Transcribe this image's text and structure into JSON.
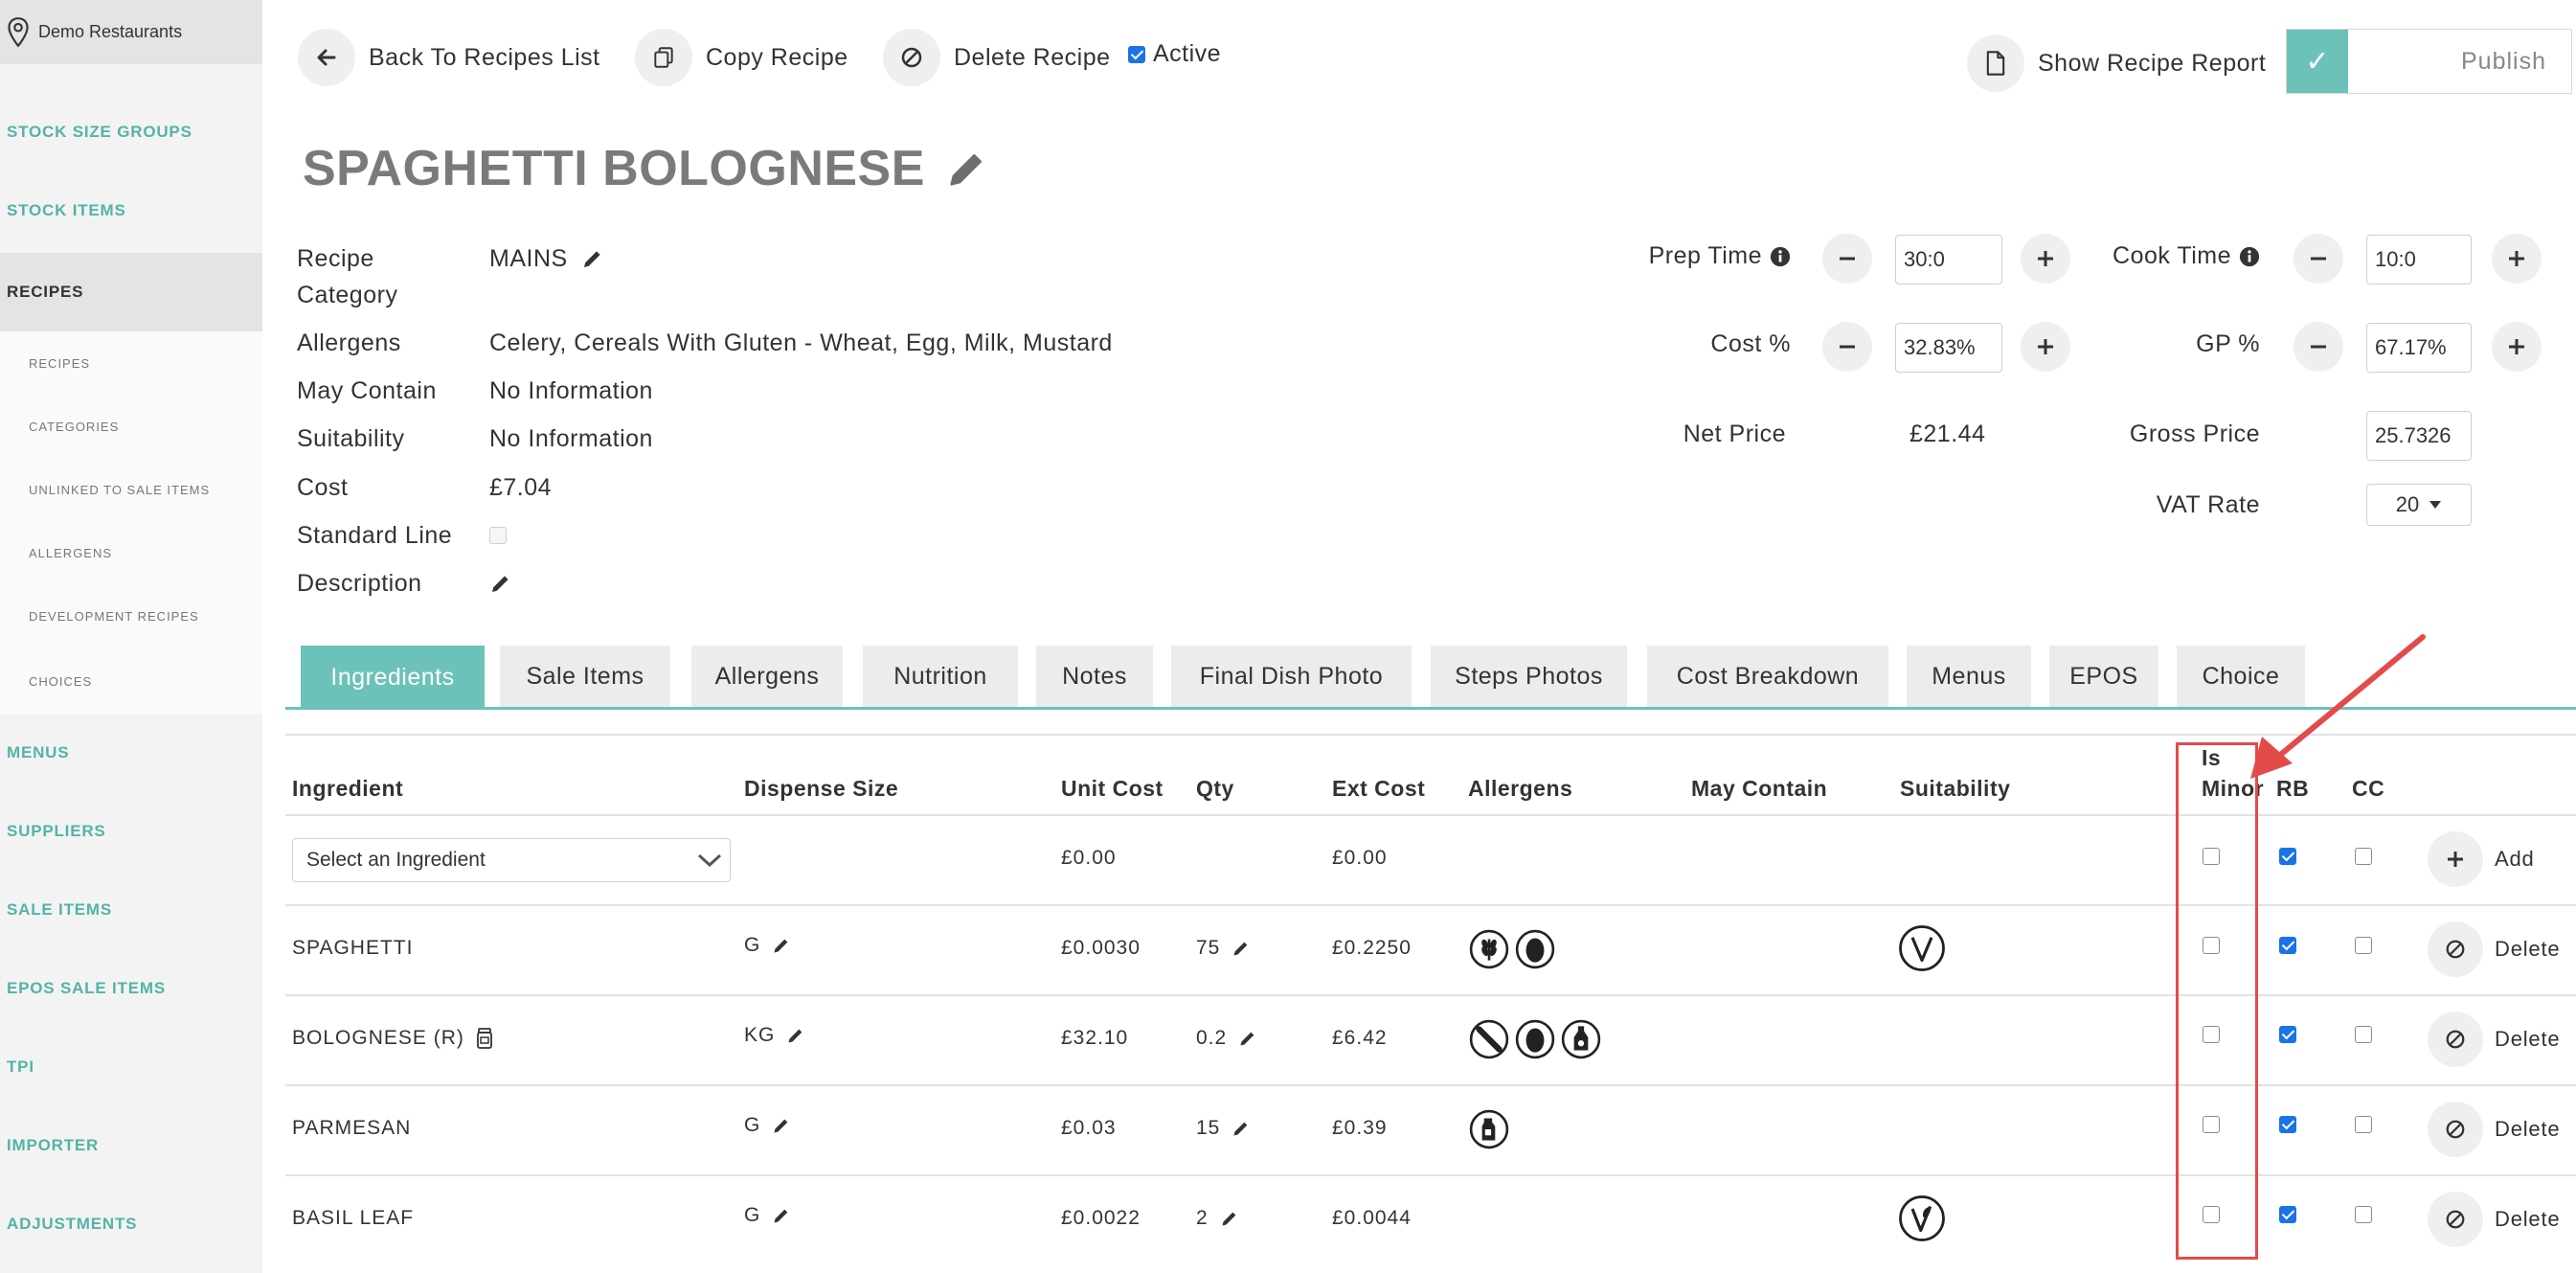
{
  "sidebar": {
    "location": "Demo Restaurants",
    "items": [
      {
        "label": "STOCK SIZE GROUPS"
      },
      {
        "label": "STOCK ITEMS"
      },
      {
        "label": "RECIPES"
      },
      {
        "label": "MENUS"
      },
      {
        "label": "SUPPLIERS"
      },
      {
        "label": "SALE ITEMS"
      },
      {
        "label": "EPOS SALE ITEMS"
      },
      {
        "label": "TPI"
      },
      {
        "label": "IMPORTER"
      },
      {
        "label": "ADJUSTMENTS"
      }
    ],
    "sub_items": [
      {
        "label": "RECIPES"
      },
      {
        "label": "CATEGORIES"
      },
      {
        "label": "UNLINKED TO SALE ITEMS"
      },
      {
        "label": "ALLERGENS"
      },
      {
        "label": "DEVELOPMENT RECIPES"
      },
      {
        "label": "CHOICES"
      }
    ]
  },
  "toolbar": {
    "back_label": "Back To Recipes List",
    "copy_label": "Copy Recipe",
    "delete_label": "Delete Recipe",
    "active_label": "Active",
    "active_checked": true,
    "report_label": "Show Recipe Report",
    "publish_label": "Publish"
  },
  "recipe": {
    "title": "SPAGHETTI BOLOGNESE",
    "info": {
      "category_label": "Recipe Category",
      "category_value": "MAINS",
      "allergens_label": "Allergens",
      "allergens_value": "Celery, Cereals With Gluten - Wheat, Egg, Milk, Mustard",
      "may_contain_label": "May Contain",
      "may_contain_value": "No Information",
      "suitability_label": "Suitability",
      "suitability_value": "No Information",
      "cost_label": "Cost",
      "cost_value": "£7.04",
      "standard_line_label": "Standard Line",
      "description_label": "Description"
    },
    "form": {
      "prep_time_label": "Prep Time",
      "prep_time_value": "30:0",
      "cook_time_label": "Cook Time",
      "cook_time_value": "10:0",
      "cost_pct_label": "Cost %",
      "cost_pct_value": "32.83%",
      "gp_pct_label": "GP %",
      "gp_pct_value": "67.17%",
      "net_price_label": "Net Price",
      "net_price_value": "£21.44",
      "gross_price_label": "Gross Price",
      "gross_price_value": "25.7326",
      "vat_rate_label": "VAT Rate",
      "vat_rate_value": "20"
    }
  },
  "tabs": [
    {
      "label": "Ingredients"
    },
    {
      "label": "Sale Items"
    },
    {
      "label": "Allergens"
    },
    {
      "label": "Nutrition"
    },
    {
      "label": "Notes"
    },
    {
      "label": "Final Dish Photo"
    },
    {
      "label": "Steps Photos"
    },
    {
      "label": "Cost Breakdown"
    },
    {
      "label": "Menus"
    },
    {
      "label": "EPOS"
    },
    {
      "label": "Choice"
    }
  ],
  "table": {
    "headers": {
      "ingredient": "Ingredient",
      "dispense_size": "Dispense Size",
      "unit_cost": "Unit Cost",
      "qty": "Qty",
      "ext_cost": "Ext Cost",
      "allergens": "Allergens",
      "may_contain": "May Contain",
      "suitability": "Suitability",
      "is_minor_1": "Is",
      "is_minor_2": "Minor",
      "rb": "RB",
      "cc": "CC"
    },
    "new_row": {
      "select_placeholder": "Select an Ingredient",
      "unit_cost": "£0.00",
      "ext_cost": "£0.00",
      "add_label": "Add"
    },
    "rows": [
      {
        "ingredient": "SPAGHETTI",
        "dispense_size": "G",
        "unit_cost": "£0.0030",
        "qty": "75",
        "ext_cost": "£0.2250",
        "allergen_icons": [
          "wheat-icon",
          "egg-icon"
        ],
        "suitability_icons": [
          "vegetarian-icon"
        ],
        "delete_label": "Delete"
      },
      {
        "ingredient": "BOLOGNESE (R)",
        "dispense_size": "KG",
        "unit_cost": "£32.10",
        "qty": "0.2",
        "ext_cost": "£6.42",
        "allergen_icons": [
          "celery-icon",
          "egg-icon",
          "mustard-icon"
        ],
        "suitability_icons": [],
        "delete_label": "Delete"
      },
      {
        "ingredient": "PARMESAN",
        "dispense_size": "G",
        "unit_cost": "£0.03",
        "qty": "15",
        "ext_cost": "£0.39",
        "allergen_icons": [
          "milk-icon"
        ],
        "suitability_icons": [],
        "delete_label": "Delete"
      },
      {
        "ingredient": "BASIL LEAF",
        "dispense_size": "G",
        "unit_cost": "£0.0022",
        "qty": "2",
        "ext_cost": "£0.0044",
        "allergen_icons": [],
        "suitability_icons": [
          "vegan-icon"
        ],
        "delete_label": "Delete"
      }
    ]
  },
  "colors": {
    "accent": "#6cc2b8",
    "sidebar_link": "#53b3a6",
    "highlight": "#e34b4b",
    "checkbox": "#1a73e8"
  }
}
